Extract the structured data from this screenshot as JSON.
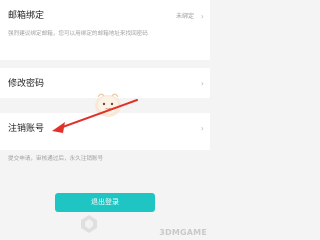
{
  "email": {
    "title": "邮箱绑定",
    "status": "未绑定",
    "desc": "强烈建议绑定邮箱，您可以用绑定的邮箱地址来找回密码"
  },
  "password": {
    "title": "修改密码"
  },
  "cancel_account": {
    "title": "注销账号",
    "desc": "提交申请，审核通过后，永久注销账号"
  },
  "logout_button": "退出登录",
  "watermark": "3DMGAME",
  "colors": {
    "accent": "#1fc5c2",
    "arrow": "#e0322b",
    "background": "#f4f4f4"
  },
  "icons": {
    "chevron": "chevron-right-icon",
    "mascot": "mascot-icon"
  }
}
